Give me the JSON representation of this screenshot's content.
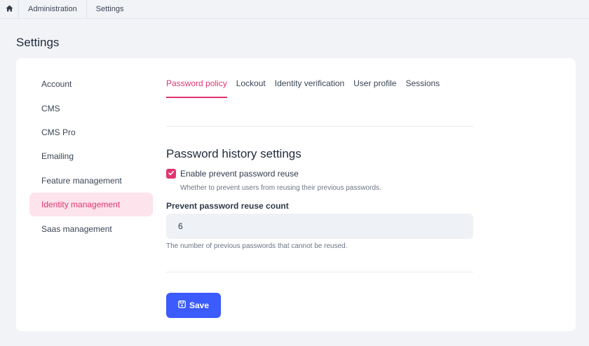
{
  "breadcrumb": {
    "home_icon": "home-icon",
    "items": [
      "Administration",
      "Settings"
    ]
  },
  "page_title": "Settings",
  "sidebar": {
    "items": [
      {
        "label": "Account",
        "active": false
      },
      {
        "label": "CMS",
        "active": false
      },
      {
        "label": "CMS Pro",
        "active": false
      },
      {
        "label": "Emailing",
        "active": false
      },
      {
        "label": "Feature management",
        "active": false
      },
      {
        "label": "Identity management",
        "active": true
      },
      {
        "label": "Saas management",
        "active": false
      }
    ]
  },
  "tabs": [
    {
      "label": "Password policy",
      "active": true
    },
    {
      "label": "Lockout",
      "active": false
    },
    {
      "label": "Identity verification",
      "active": false
    },
    {
      "label": "User profile",
      "active": false
    },
    {
      "label": "Sessions",
      "active": false
    }
  ],
  "form": {
    "section_title": "Password history settings",
    "checkbox": {
      "label": "Enable prevent password reuse",
      "checked": true,
      "help": "Whether to prevent users from reusing their previous passwords."
    },
    "reuse_count": {
      "label": "Prevent password reuse count",
      "value": "6",
      "help": "The number of previous passwords that cannot be reused."
    },
    "save_label": "Save",
    "save_icon": "floppy-disk-icon"
  },
  "colors": {
    "accent": "#e0366f",
    "accent_bg": "#fde3ec",
    "primary_button": "#3b5bfd"
  }
}
